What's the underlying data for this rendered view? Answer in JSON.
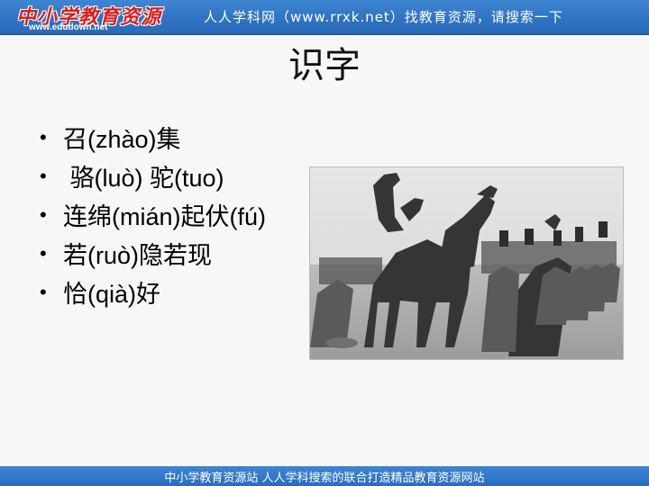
{
  "header": {
    "logo_text": "中小学教育资源",
    "logo_url": "www.edudown.net",
    "banner": "人人学科网（www.rrxk.net）找教育资源，请搜索一下"
  },
  "slide": {
    "title": "识字",
    "items": [
      {
        "bullet": "•",
        "text": "召(zhào)集"
      },
      {
        "bullet": "•",
        "text": " 骆(luò) 驼(tuo)"
      },
      {
        "bullet": "•",
        "text": "连绵(mián)起伏(fú)"
      },
      {
        "bullet": "•",
        "text": "若(ruò)隐若现"
      },
      {
        "bullet": "•",
        "text": "恰(qià)好"
      }
    ],
    "photo_icon": "camel-caravan-photo"
  },
  "footer": {
    "text": "中小学教育资源站 人人学科搜索的联合打造精品教育资源网站"
  },
  "colors": {
    "header_blue": "#2f73c4",
    "logo_red": "#d62020",
    "background": "#f7f7f7"
  }
}
